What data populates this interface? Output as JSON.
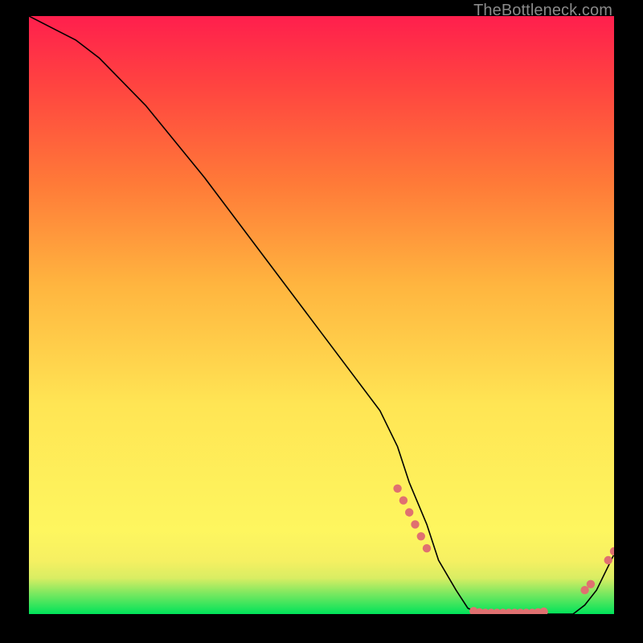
{
  "watermark": "TheBottleneck.com",
  "colors": {
    "background_frame": "#000000",
    "gradient_top": "#ff1f4d",
    "gradient_bottom": "#00e35a",
    "curve": "#000000",
    "dots": "#e07070",
    "watermark": "#8a8a8a"
  },
  "chart_data": {
    "type": "line",
    "title": "",
    "xlabel": "",
    "ylabel": "",
    "xlim": [
      0,
      100
    ],
    "ylim": [
      0,
      100
    ],
    "x": [
      0,
      4,
      8,
      12,
      20,
      30,
      40,
      50,
      60,
      63,
      65,
      68,
      70,
      73,
      75,
      77,
      80,
      83,
      85,
      88,
      90,
      93,
      95,
      97,
      100
    ],
    "values": [
      100,
      98,
      96,
      93,
      85,
      73,
      60,
      47,
      34,
      28,
      22,
      15,
      9,
      4,
      1,
      0,
      0,
      0,
      0,
      0,
      0,
      0,
      1.5,
      4,
      10
    ],
    "highlighted_points": [
      {
        "x": 63,
        "y": 21
      },
      {
        "x": 64,
        "y": 19
      },
      {
        "x": 65,
        "y": 17
      },
      {
        "x": 66,
        "y": 15
      },
      {
        "x": 67,
        "y": 13
      },
      {
        "x": 68,
        "y": 11
      },
      {
        "x": 76,
        "y": 0.5
      },
      {
        "x": 77,
        "y": 0.3
      },
      {
        "x": 78,
        "y": 0.2
      },
      {
        "x": 79,
        "y": 0.2
      },
      {
        "x": 80,
        "y": 0.2
      },
      {
        "x": 81,
        "y": 0.2
      },
      {
        "x": 82,
        "y": 0.2
      },
      {
        "x": 83,
        "y": 0.2
      },
      {
        "x": 84,
        "y": 0.2
      },
      {
        "x": 85,
        "y": 0.2
      },
      {
        "x": 86,
        "y": 0.2
      },
      {
        "x": 87,
        "y": 0.3
      },
      {
        "x": 88,
        "y": 0.4
      },
      {
        "x": 95,
        "y": 4
      },
      {
        "x": 96,
        "y": 5
      },
      {
        "x": 99,
        "y": 9
      },
      {
        "x": 100,
        "y": 10.5
      }
    ],
    "gradient_bands": [
      {
        "stop": 0.0,
        "color": "#00e35a"
      },
      {
        "stop": 0.035,
        "color": "#7de860"
      },
      {
        "stop": 0.06,
        "color": "#d9ed63"
      },
      {
        "stop": 0.09,
        "color": "#f6f062"
      },
      {
        "stop": 0.14,
        "color": "#fef65f"
      },
      {
        "stop": 0.35,
        "color": "#ffe554"
      },
      {
        "stop": 0.55,
        "color": "#ffb53f"
      },
      {
        "stop": 0.72,
        "color": "#ff7a38"
      },
      {
        "stop": 0.88,
        "color": "#ff4540"
      },
      {
        "stop": 1.0,
        "color": "#ff1f4d"
      }
    ]
  }
}
